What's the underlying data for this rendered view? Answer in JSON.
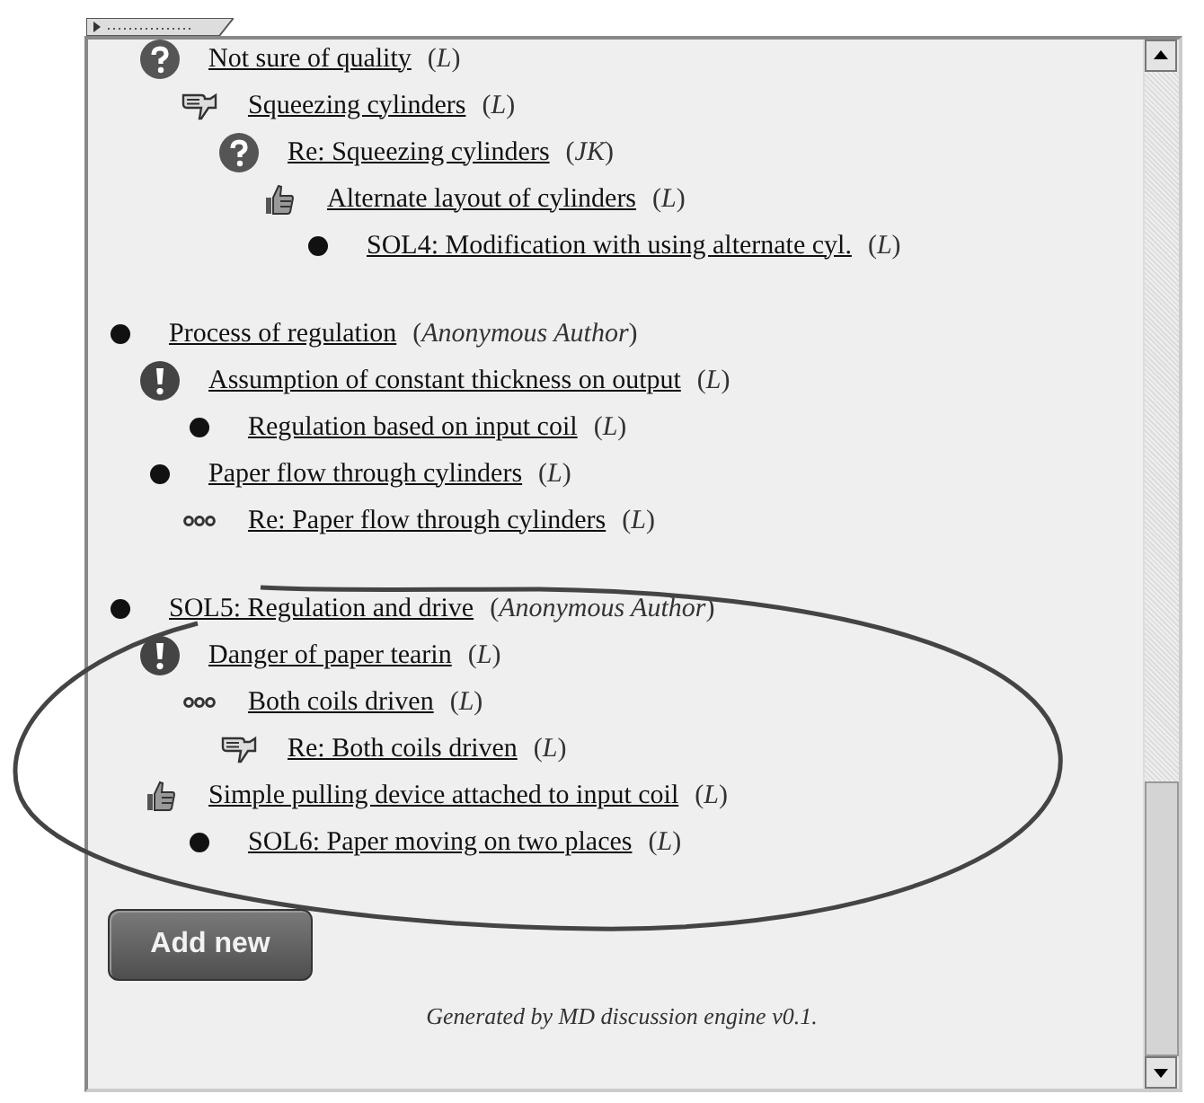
{
  "threads": [
    {
      "children": [
        {
          "kind": "question",
          "title": "Not sure of quality",
          "author": "(*L*)",
          "children": [
            {
              "kind": "thumbs-down",
              "title": "Squeezing cylinders",
              "author": "(*L*)",
              "children": [
                {
                  "kind": "question",
                  "title": "Re: Squeezing cylinders",
                  "author": "(*JK*)",
                  "children": [
                    {
                      "kind": "thumbs-up",
                      "title": "Alternate layout of cylinders",
                      "author": "(*L*)",
                      "children": [
                        {
                          "kind": "bullet",
                          "title": "SOL4: Modification with using alternate cyl.",
                          "author": "(*L*)"
                        }
                      ]
                    }
                  ]
                }
              ]
            }
          ]
        }
      ]
    },
    {
      "kind": "bullet",
      "title": "Process of regulation",
      "author": "(*Anonymous Author*)",
      "children": [
        {
          "kind": "exclamation",
          "title": "Assumption of constant thickness on output",
          "author": "(*L*)",
          "children": [
            {
              "kind": "bullet",
              "title": "Regulation based on input coil",
              "author": "(*L*)"
            }
          ]
        },
        {
          "kind": "bullet",
          "title": "Paper flow through cylinders",
          "author": "(*L*)",
          "children": [
            {
              "kind": "dots",
              "title": "Re: Paper flow through cylinders",
              "author": "(*L*)"
            }
          ]
        }
      ]
    },
    {
      "kind": "bullet",
      "title": "SOL5: Regulation and drive",
      "author": "(*Anonymous Author*)",
      "children": [
        {
          "kind": "exclamation",
          "title": "Danger of paper tearin",
          "author": "(*L*)",
          "children": [
            {
              "kind": "dots",
              "title": "Both coils driven",
              "author": "(*L*)",
              "children": [
                {
                  "kind": "thumbs-down",
                  "title": "Re: Both coils driven",
                  "author": "(*L*)"
                }
              ]
            }
          ]
        },
        {
          "kind": "thumbs-up",
          "title": "Simple pulling device attached to input coil",
          "author": "(*L*)",
          "children": [
            {
              "kind": "bullet",
              "title": "SOL6: Paper moving on two places",
              "author": "(*L*)"
            }
          ]
        }
      ]
    }
  ],
  "add_button": "Add new",
  "footer": "Generated by MD discussion engine v0.1."
}
